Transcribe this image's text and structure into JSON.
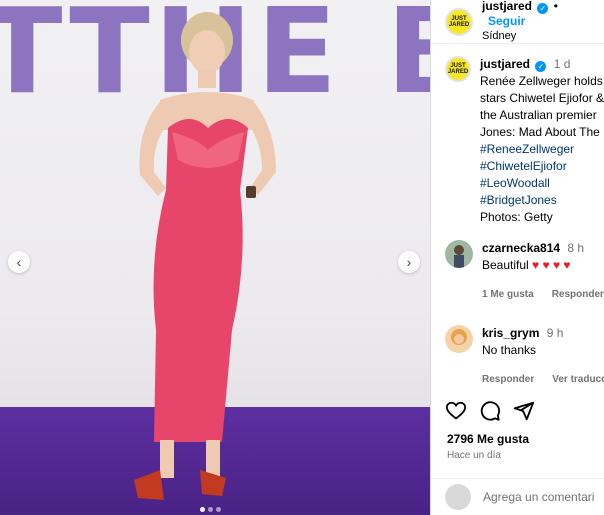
{
  "post": {
    "backdrop_text": "TTHE BO",
    "author": "justjared",
    "avatar_logo_line1": "JUST",
    "avatar_logo_line2": "JARED",
    "follow_label": "Seguir",
    "location": "Sídney",
    "caption_time": "1 d",
    "caption_lines": [
      "Renée Zellweger holds",
      "stars Chiwetel Ejiofor &",
      "the Australian premier",
      "Jones: Mad About The"
    ],
    "hashtags": [
      "#ReneeZellweger",
      "#ChiwetelEjiofor",
      "#LeoWoodall",
      "#BridgetJones"
    ],
    "photo_credit": "Photos: Getty",
    "likes": "2796 Me gusta",
    "posted_ago": "Hace un día",
    "add_comment_placeholder": "Agrega un comentari"
  },
  "comments": [
    {
      "user": "czarnecka814",
      "time": "8 h",
      "text": "Beautiful",
      "hearts": "♥ ♥ ♥ ♥",
      "like_label": "1 Me gusta",
      "reply_label": "Responder"
    },
    {
      "user": "kris_grym",
      "time": "9 h",
      "text": "No thanks",
      "reply_label": "Responder",
      "translate_label": "Ver traducci"
    }
  ],
  "colors": {
    "accent": "#0095f6",
    "avatar_yellow": "#f6e827",
    "dress_pink": "#e8456a",
    "floor_purple": "#5d2fa0"
  },
  "icons": [
    "heart-icon",
    "comment-icon",
    "share-icon",
    "chevron-left-icon",
    "chevron-right-icon",
    "verified-icon"
  ]
}
